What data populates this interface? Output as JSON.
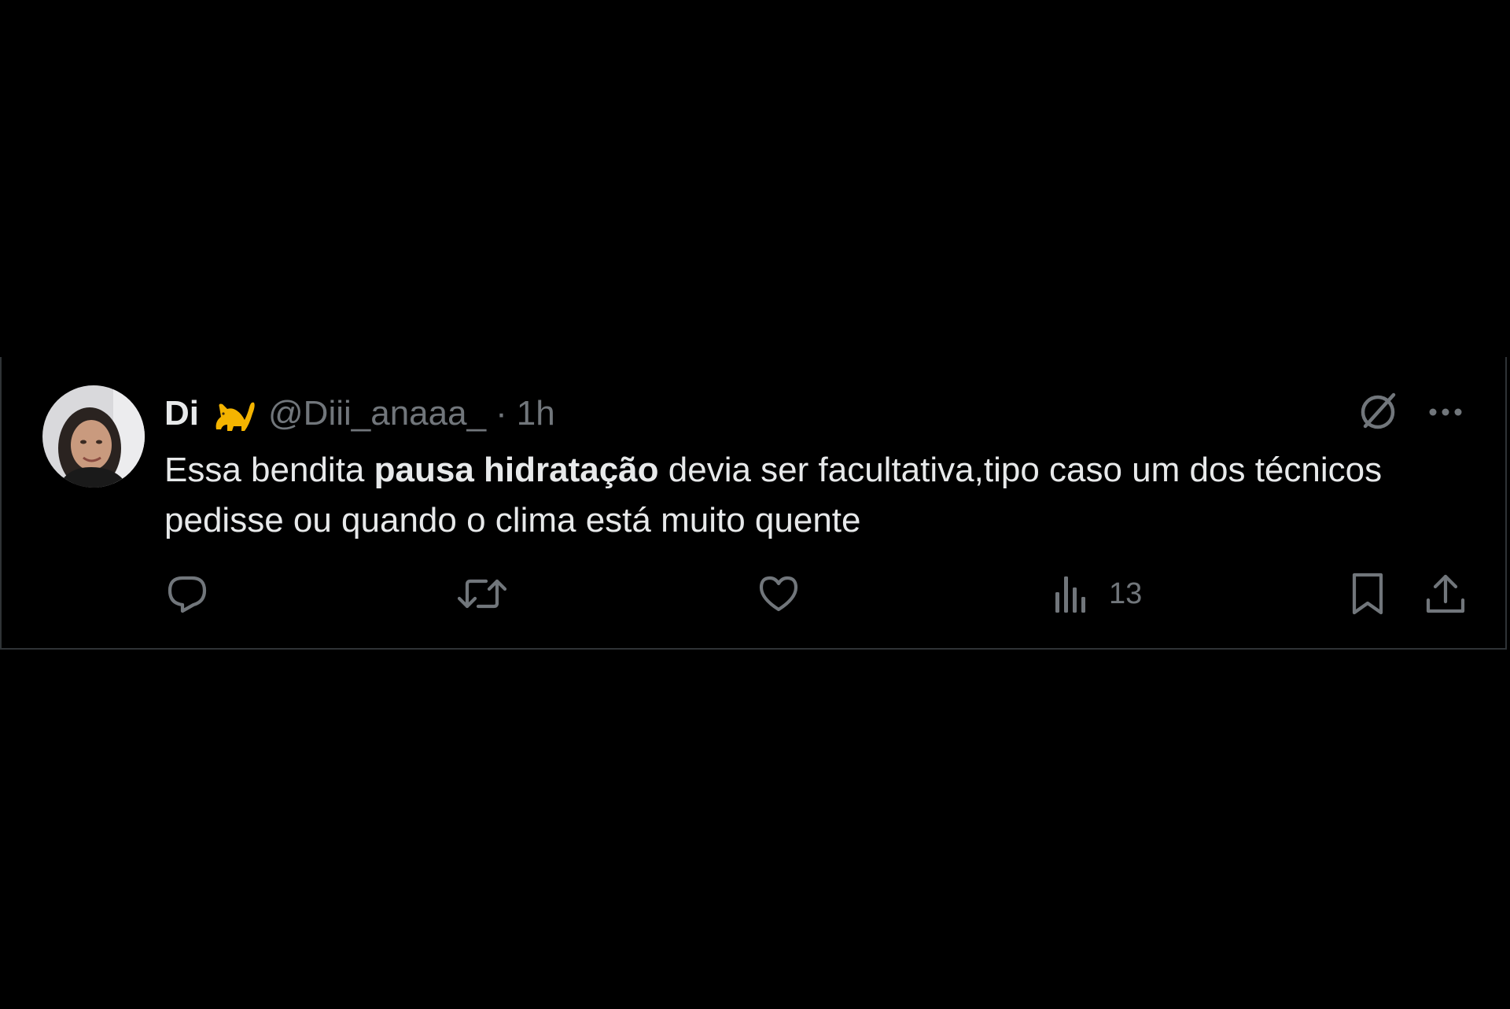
{
  "tweet": {
    "display_name": "Di",
    "name_emoji": "🐈",
    "handle": "@Diii_anaaa_",
    "separator": "·",
    "time": "1h",
    "text_before": "Essa bendita ",
    "text_bold": "pausa hidratação",
    "text_after": " devia ser facultativa,tipo caso um dos técnicos pedisse ou quando o clima está muito quente"
  },
  "actions": {
    "reply_icon": "reply-icon",
    "retweet_icon": "retweet-icon",
    "like_icon": "heart-icon",
    "views_icon": "views-chart-icon",
    "views_count": "13",
    "bookmark_icon": "bookmark-icon",
    "share_icon": "share-icon"
  },
  "colors": {
    "background": "#000000",
    "border": "#2f3336",
    "text_primary": "#e7e9ea",
    "text_secondary": "#71767b",
    "cat_emoji": "#f4b400"
  }
}
